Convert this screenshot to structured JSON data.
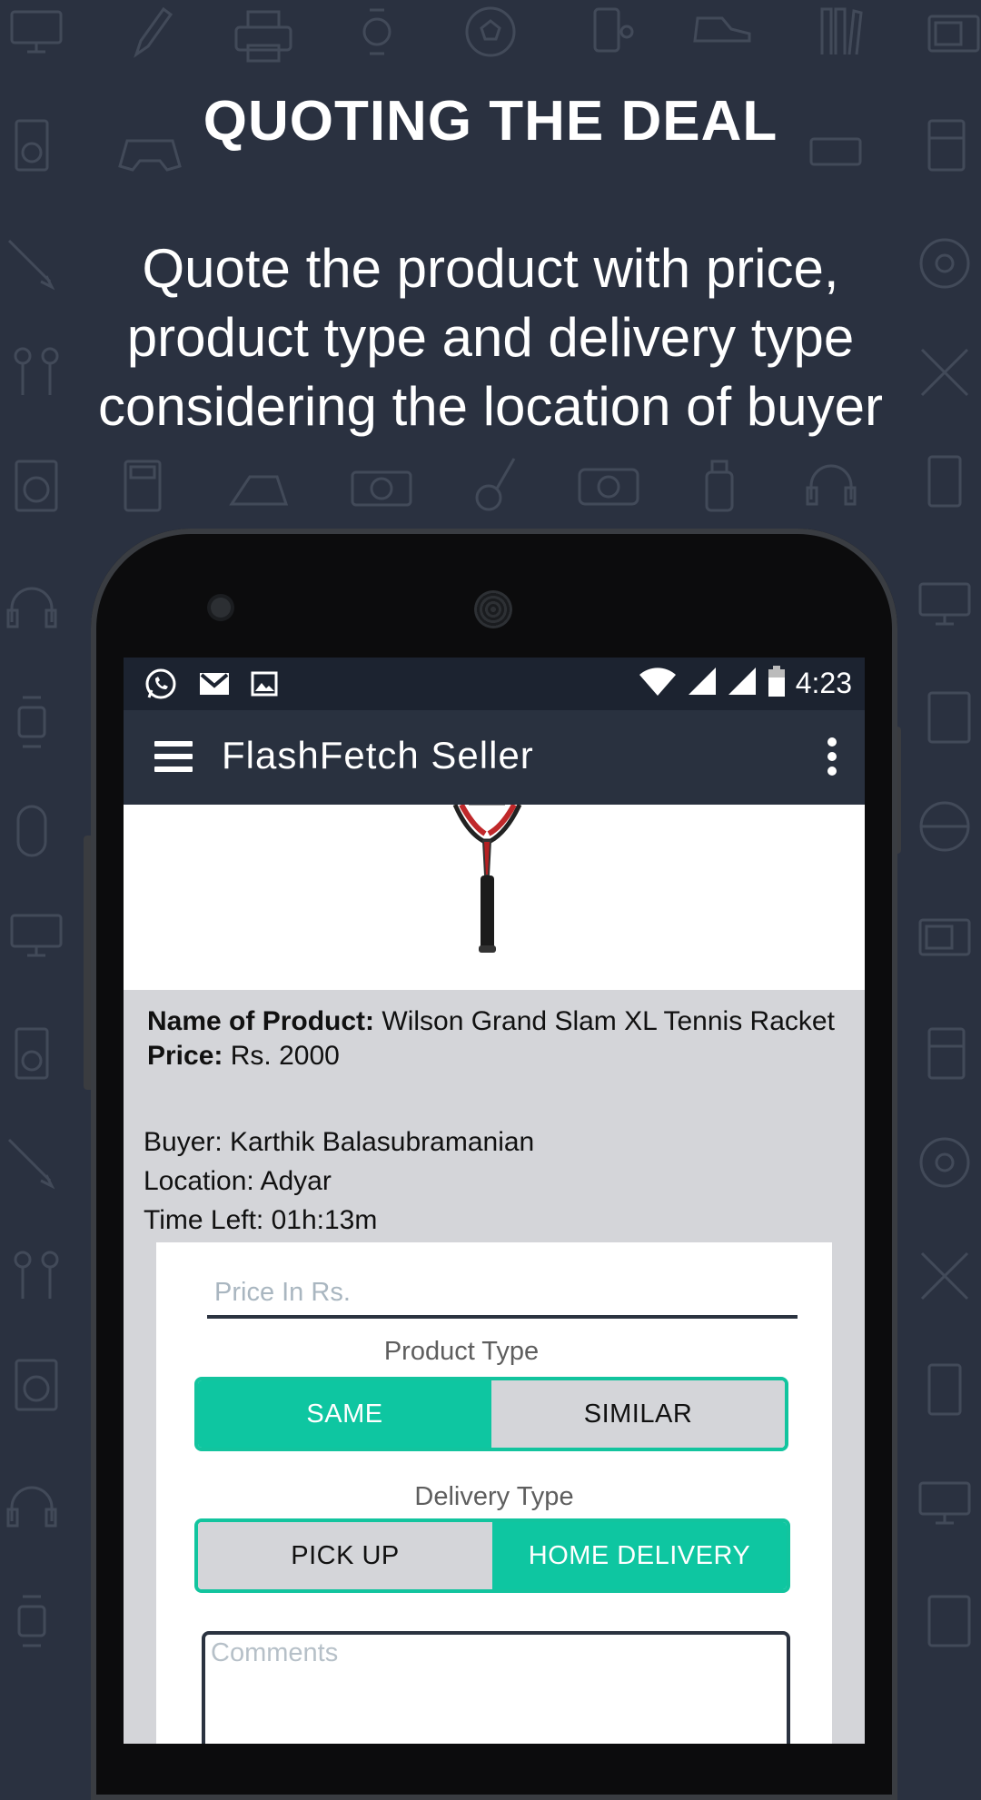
{
  "promo": {
    "headline": "QUOTING THE DEAL",
    "subline": "Quote the product with price, product type and delivery type considering the location of buyer"
  },
  "status_bar": {
    "time": "4:23",
    "notification_icons": [
      "whatsapp-icon",
      "gmail-icon",
      "image-icon"
    ],
    "system_icons": [
      "wifi-icon",
      "signal-icon",
      "signal-icon",
      "battery-icon"
    ]
  },
  "app_bar": {
    "title": "FlashFetch Seller"
  },
  "product": {
    "name_label": "Name of Product:",
    "name_value": "Wilson Grand Slam XL Tennis Racket",
    "price_label": "Price:",
    "price_value": "Rs. 2000",
    "image": "tennis-racket"
  },
  "buyer": {
    "buyer_line": "Buyer: Karthik Balasubramanian",
    "location_line": "Location: Adyar",
    "time_left_line": "Time Left: 01h:13m"
  },
  "form": {
    "price_placeholder": "Price In Rs.",
    "product_type_label": "Product Type",
    "product_type_options": [
      "SAME",
      "SIMILAR"
    ],
    "product_type_selected": "SAME",
    "delivery_type_label": "Delivery Type",
    "delivery_type_options": [
      "PICK UP",
      "HOME DELIVERY"
    ],
    "delivery_type_selected": "HOME DELIVERY",
    "comments_placeholder": "Comments"
  },
  "colors": {
    "background": "#2a3140",
    "accent": "#0ec6a1",
    "appbar": "#29313f"
  }
}
